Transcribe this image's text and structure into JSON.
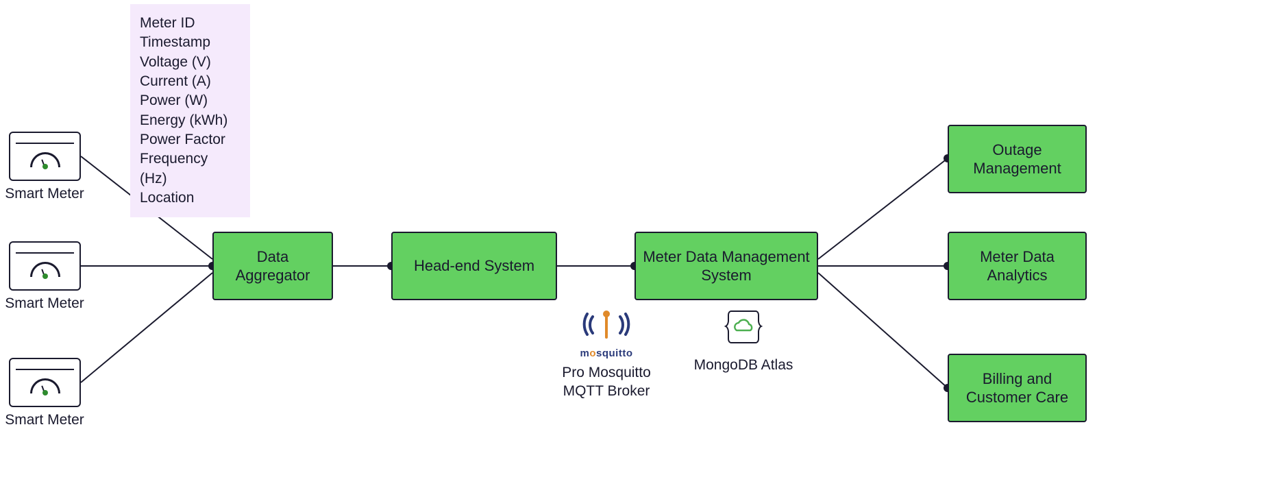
{
  "meters": {
    "label": "Smart Meter"
  },
  "schema": {
    "fields": [
      "Meter ID",
      "Timestamp",
      "Voltage (V)",
      "Current (A)",
      "Power (W)",
      "Energy (kWh)",
      "Power Factor",
      "Frequency (Hz)",
      "Location"
    ]
  },
  "nodes": {
    "aggregator": "Data Aggregator",
    "head_end": "Head-end System",
    "mdms": "Meter Data Management System",
    "outage": "Outage Management",
    "analytics": "Meter Data Analytics",
    "billing": "Billing and Customer Care"
  },
  "logos": {
    "mosquitto_wordmark": "mosquitto",
    "mosquitto_caption": "Pro Mosquitto MQTT Broker",
    "mongodb_caption": "MongoDB Atlas"
  }
}
